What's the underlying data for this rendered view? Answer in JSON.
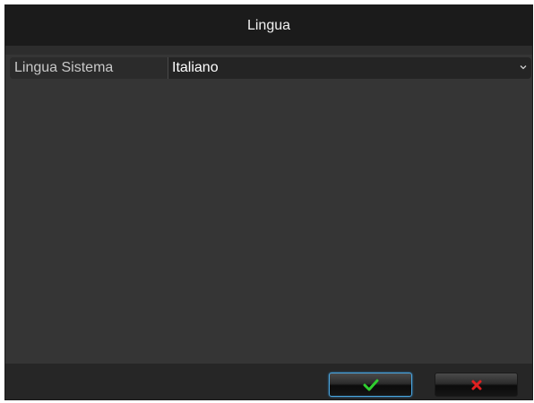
{
  "dialog": {
    "title": "Lingua"
  },
  "settings": {
    "system_language_label": "Lingua Sistema",
    "system_language_value": "Italiano"
  },
  "footer": {
    "ok_icon": "checkmark-icon",
    "cancel_icon": "close-icon"
  },
  "colors": {
    "ok_green": "#2fcf2f",
    "cancel_red": "#e02020",
    "focus_border": "#4aa6e0"
  }
}
